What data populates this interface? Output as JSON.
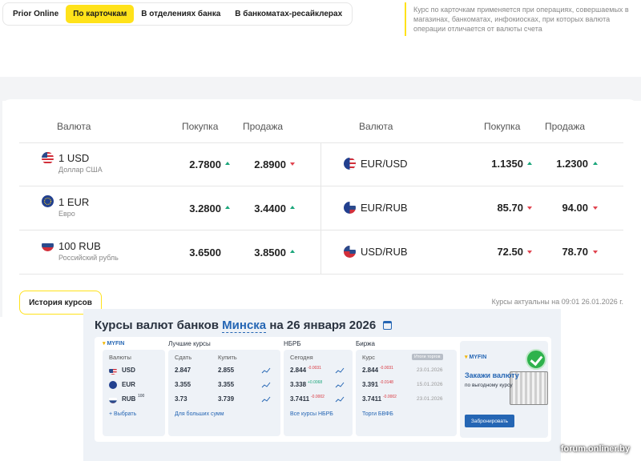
{
  "tabs": [
    "Prior Online",
    "По карточкам",
    "В отделениях банка",
    "В банкоматах-ресайклерах"
  ],
  "note": "Курс по карточкам применяется при операциях, совершаемых в магазинах, банкоматах, инфокиосках, при которых валюта операции отличается от валюты счета",
  "table": {
    "left_headers": {
      "currency": "Валюта",
      "buy": "Покупка",
      "sell": "Продажа"
    },
    "right_headers": {
      "currency": "Валюта",
      "buy": "Покупка",
      "sell": "Продажа"
    },
    "left_rows": [
      {
        "flag": "us-flag-icon",
        "name": "1 USD",
        "desc": "Доллар США",
        "buy": "2.7800",
        "buy_dir": "up",
        "sell": "2.8900",
        "sell_dir": "down"
      },
      {
        "flag": "eu-flag-icon",
        "name": "1 EUR",
        "desc": "Евро",
        "buy": "3.2800",
        "buy_dir": "up",
        "sell": "3.4400",
        "sell_dir": "up"
      },
      {
        "flag": "ru-flag-icon",
        "name": "100 RUB",
        "desc": "Российский рубль",
        "buy": "3.6500",
        "buy_dir": "none",
        "sell": "3.8500",
        "sell_dir": "up"
      }
    ],
    "right_rows": [
      {
        "flag": "eur-usd-flag-icon",
        "name": "EUR/USD",
        "buy": "1.1350",
        "buy_dir": "up",
        "sell": "1.2300",
        "sell_dir": "up"
      },
      {
        "flag": "eur-rub-flag-icon",
        "name": "EUR/RUB",
        "buy": "85.70",
        "buy_dir": "down",
        "sell": "94.00",
        "sell_dir": "down"
      },
      {
        "flag": "usd-rub-flag-icon",
        "name": "USD/RUB",
        "buy": "72.50",
        "buy_dir": "down",
        "sell": "78.70",
        "sell_dir": "down"
      }
    ]
  },
  "history_button": "История курсов",
  "updated": "Курсы актуальны на 09:01 26.01.2026 г.",
  "widget": {
    "title_prefix": "Курсы валют банков",
    "city": "Минска",
    "title_suffix": "на 26 января 2026",
    "logo": "MYFIN",
    "currencies_label": "Валюты",
    "currencies": [
      "USD",
      "EUR",
      "RUB"
    ],
    "rub_units": "100",
    "add_link": "+ Выбрать",
    "best": {
      "label": "Лучшие курсы",
      "sell_head": "Сдать",
      "buy_head": "Купить",
      "rows": [
        [
          "2.847",
          "2.855"
        ],
        [
          "3.355",
          "3.355"
        ],
        [
          "3.73",
          "3.739"
        ]
      ],
      "link": "Для больших сумм"
    },
    "nbrb": {
      "label": "НБРБ",
      "head": "Сегодня",
      "rows": [
        {
          "value": "2.844",
          "change": "-0.0031",
          "dir": "neg"
        },
        {
          "value": "3.338",
          "change": "+0.0068",
          "dir": "pos"
        },
        {
          "value": "3.7411",
          "change": "-0.0002",
          "dir": "neg"
        }
      ],
      "link": "Все курсы НБРБ"
    },
    "exchange": {
      "label": "Биржа",
      "head": "Курс",
      "badge": "Итоги торгов",
      "rows": [
        {
          "value": "2.844",
          "change": "-0.0031",
          "date": "23.01.2026"
        },
        {
          "value": "3.391",
          "change": "-0.0148",
          "date": "15.01.2026"
        },
        {
          "value": "3.7411",
          "change": "-0.0002",
          "date": "23.01.2026"
        }
      ],
      "link": "Торги БВФБ"
    },
    "ad": {
      "logo": "MYFIN",
      "title": "Закажи валюту",
      "sub": "по выгодному курсу",
      "button": "Забронировать"
    }
  },
  "watermark": "forum.onliner.by",
  "colors": {
    "accent": "#ffe21a",
    "up": "#1aa67a",
    "down": "#e0434f",
    "link": "#2566b4"
  }
}
